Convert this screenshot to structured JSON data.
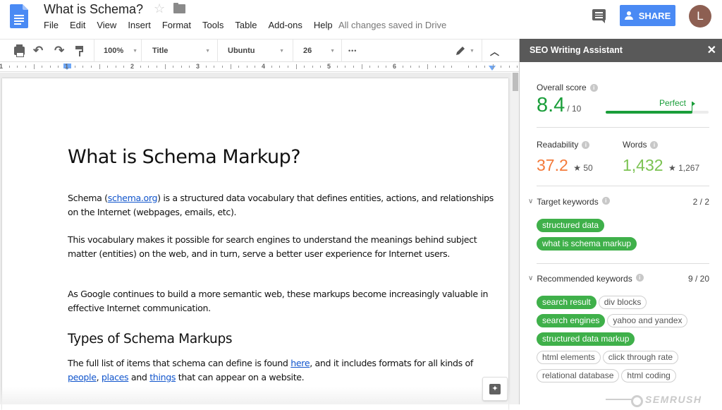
{
  "header": {
    "title": "What is Schema?",
    "menu": [
      "File",
      "Edit",
      "View",
      "Insert",
      "Format",
      "Tools",
      "Table",
      "Add-ons",
      "Help"
    ],
    "save_status": "All changes saved in Drive",
    "share_label": "SHARE",
    "avatar_initial": "L",
    "brand_color": "#4a8af4"
  },
  "toolbar": {
    "zoom": "100%",
    "style": "Title",
    "font": "Ubuntu",
    "size": "26",
    "more": "•••"
  },
  "ruler": {
    "numbers": [
      "1",
      "1",
      "2",
      "3",
      "4",
      "5",
      "6"
    ]
  },
  "document": {
    "heading": "What is Schema Markup?",
    "p1_before": "Schema (",
    "p1_link": "schema.org",
    "p1_after": ") is a structured data vocabulary that defines entities, actions, and relationships on the Internet (webpages, emails, etc).",
    "p2": "This vocabulary makes it possible for search engines to understand the meanings behind subject matter (entities) on the web, and in turn, serve a better user experience for Internet users.",
    "p3": "As Google continues to build a more semantic web, these markups become increasingly valuable in effective Internet communication.",
    "subheading": "Types of Schema Markups",
    "p4_a": "The full list of items that schema can define is found ",
    "p4_link_here": "here",
    "p4_b": ", and it includes formats for all kinds of ",
    "p4_link_people": "people",
    "p4_c": ", ",
    "p4_link_places": "places",
    "p4_d": " and ",
    "p4_link_things": "things",
    "p4_e": " that can appear on a website."
  },
  "seo_panel": {
    "title": "SEO Writing Assistant",
    "close": "✕",
    "overall_label": "Overall score",
    "overall_score": "8.4",
    "overall_max": "/ 10",
    "overall_progress_fraction": 0.84,
    "perfect_label": "Perfect",
    "readability_label": "Readability",
    "readability_value": "37.2",
    "readability_target": "50",
    "words_label": "Words",
    "words_value": "1,432",
    "words_target": "1,267",
    "target_keywords_label": "Target keywords",
    "target_keywords_count": "2 / 2",
    "target_keywords": [
      {
        "text": "structured data",
        "used": true
      },
      {
        "text": "what is schema markup",
        "used": true
      }
    ],
    "recommended_keywords_label": "Recommended keywords",
    "recommended_keywords_count": "9 / 20",
    "recommended_keywords": [
      {
        "text": "search result",
        "used": true
      },
      {
        "text": "div blocks",
        "used": false
      },
      {
        "text": "search engines",
        "used": true
      },
      {
        "text": "yahoo and yandex",
        "used": false
      },
      {
        "text": "structured data markup",
        "used": true
      },
      {
        "text": "html elements",
        "used": false
      },
      {
        "text": "click through rate",
        "used": false
      },
      {
        "text": "relational database",
        "used": false
      },
      {
        "text": "html coding",
        "used": false
      }
    ],
    "brand": "SEMRUSH",
    "colors": {
      "score_green": "#1a9e3a",
      "readability_orange": "#f47a3a",
      "words_green": "#7cc353",
      "chip_green": "#3fb04a"
    }
  }
}
